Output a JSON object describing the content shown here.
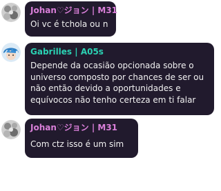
{
  "messages": [
    {
      "author": "Johan♡ジョン | M31",
      "author_color": "#d97fd9",
      "text": "Oi vc é tchola ou n",
      "avatar": "grayscale-flower-avatar"
    },
    {
      "author": "Gabrilles | A05s",
      "author_color": "#2bd1b3",
      "text": "Depende da ocasião opcionada sobre o universo composto por chances de ser ou não então devido a oportunidades e equívocos não tenho certeza em ti falar",
      "avatar": "anime-character-avatar"
    },
    {
      "author": "Johan♡ジョン | M31",
      "author_color": "#d97fd9",
      "text": "Com ctz isso é um sim",
      "avatar": "grayscale-flower-avatar"
    }
  ]
}
